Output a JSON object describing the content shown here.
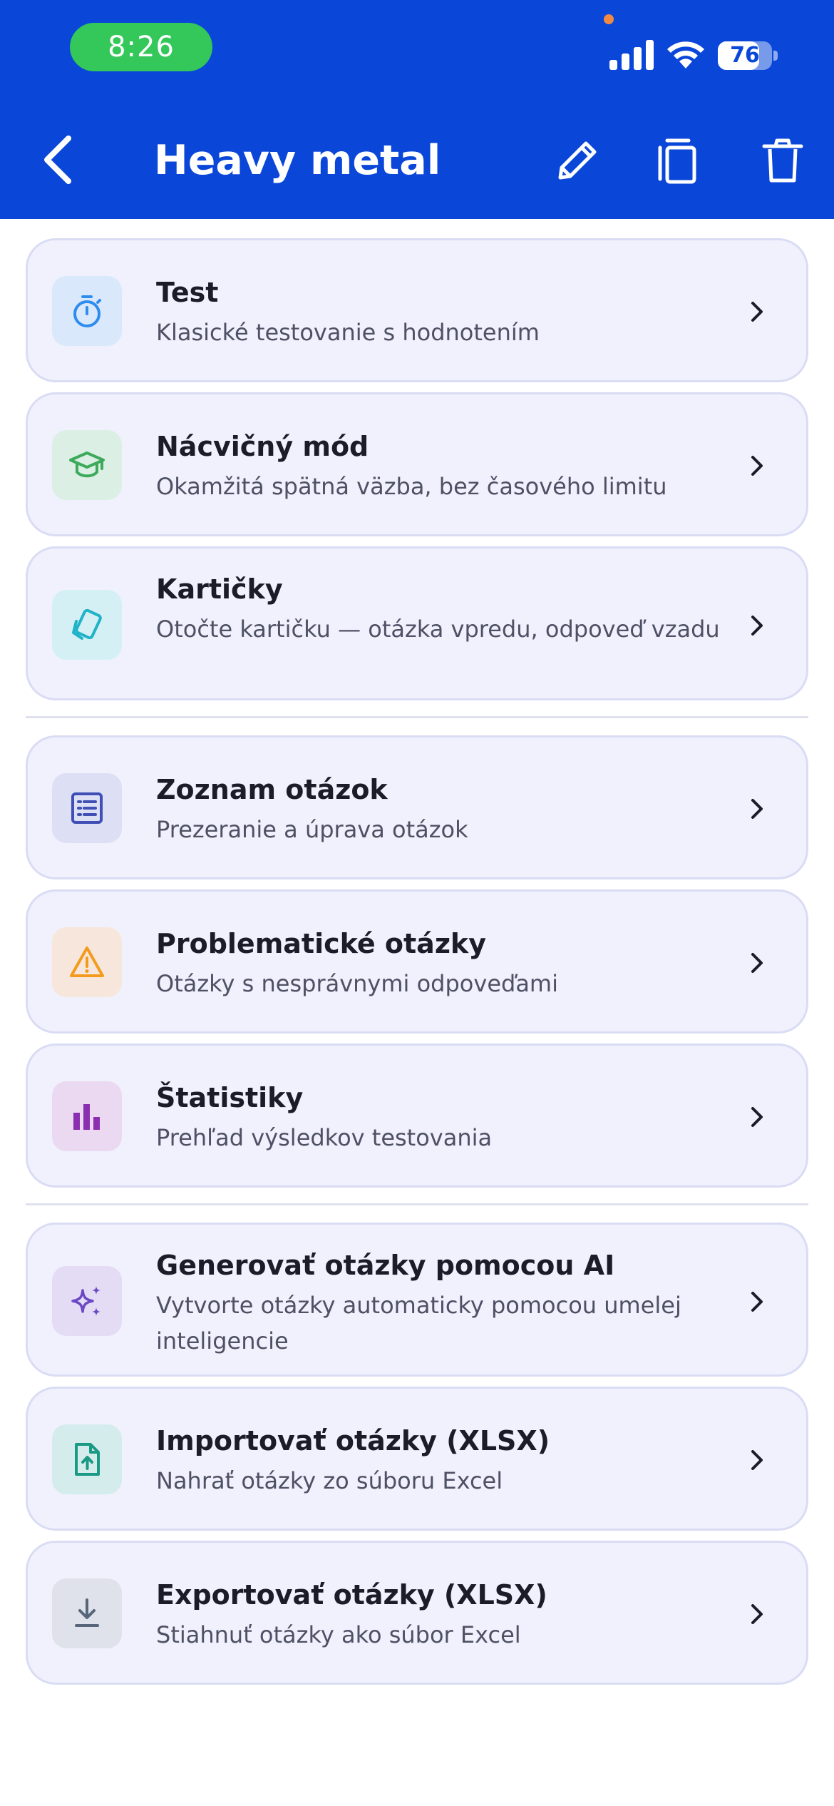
{
  "status": {
    "time": "8:26",
    "battery": "76",
    "battery_level": 0.76
  },
  "nav": {
    "title": "Heavy metal",
    "back_icon": "chevron-left-icon",
    "edit_icon": "pencil-icon",
    "copy_icon": "copy-icon",
    "delete_icon": "trash-icon"
  },
  "sections": [
    {
      "items": [
        {
          "title": "Test",
          "subtitle": "Klasické testovanie s hodnotením",
          "icon": "stopwatch-icon",
          "color": "#2f8cef",
          "tile": "#d9e9fb"
        },
        {
          "title": "Nácvičný mód",
          "subtitle": "Okamžitá spätná väzba, bez časového limitu",
          "icon": "graduation-cap-icon",
          "color": "#3caa5a",
          "tile": "#dcefe4"
        },
        {
          "title": "Kartičky",
          "subtitle": "Otočte kartičku — otázka vpredu, odpoveď vzadu",
          "icon": "flashcards-icon",
          "color": "#20b3c8",
          "tile": "#d5f0f5"
        }
      ]
    },
    {
      "items": [
        {
          "title": "Zoznam otázok",
          "subtitle": "Prezeranie a úprava otázok",
          "icon": "list-icon",
          "color": "#3f4fb5",
          "tile": "#dde0f5"
        },
        {
          "title": "Problematické otázky",
          "subtitle": "Otázky s nesprávnymi odpoveďami",
          "icon": "warning-icon",
          "color": "#f29b1d",
          "tile": "#f7e6dc"
        },
        {
          "title": "Štatistiky",
          "subtitle": "Prehľad výsledkov testovania",
          "icon": "bar-chart-icon",
          "color": "#8a2fb0",
          "tile": "#ead9f1"
        }
      ]
    },
    {
      "items": [
        {
          "title": "Generovať otázky pomocou AI",
          "subtitle": "Vytvorte otázky automaticky pomocou umelej inteligencie",
          "icon": "sparkles-icon",
          "color": "#6b48c4",
          "tile": "#e4dcf5"
        },
        {
          "title": "Importovať otázky (XLSX)",
          "subtitle": "Nahrať otázky zo súboru Excel",
          "icon": "file-upload-icon",
          "color": "#1a9a84",
          "tile": "#d5ecec"
        },
        {
          "title": "Exportovať otázky (XLSX)",
          "subtitle": "Stiahnuť otázky ako súbor Excel",
          "icon": "download-icon",
          "color": "#57667a",
          "tile": "#dfe2ea"
        }
      ]
    }
  ]
}
